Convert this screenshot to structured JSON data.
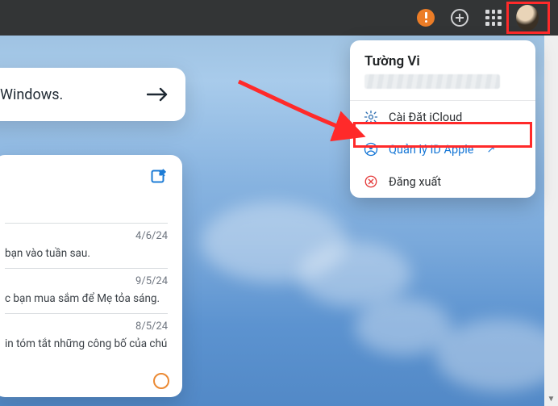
{
  "toolbar": {
    "alert_icon": "alert-icon",
    "add_icon": "plus-icon",
    "apps_icon": "apps-grid-icon",
    "avatar_icon": "user-avatar"
  },
  "account_menu": {
    "display_name": "Tường Vi",
    "items": [
      {
        "icon": "gear-icon",
        "label": "Cài Đặt iCloud",
        "link_out": false,
        "accent": "neutral"
      },
      {
        "icon": "person-icon",
        "label": "Quản lý ID Apple",
        "link_out": true,
        "accent": "blue"
      },
      {
        "icon": "x-icon",
        "label": "Đăng xuất",
        "link_out": false,
        "accent": "red"
      }
    ]
  },
  "banner": {
    "text": "Windows."
  },
  "notes": {
    "compose_icon": "compose-icon",
    "rows": [
      {
        "date": "4/6/24",
        "text": "bạn vào tuần sau."
      },
      {
        "date": "9/5/24",
        "text": "c bạn mua sắm để Mẹ tỏa sáng."
      },
      {
        "date": "8/5/24",
        "text": "in tóm tắt những công bố của chú…"
      }
    ],
    "status_icon": "sync-status-icon"
  },
  "colors": {
    "highlight": "#ff2a2a",
    "link": "#1777d6",
    "warning": "#ec7d27"
  }
}
